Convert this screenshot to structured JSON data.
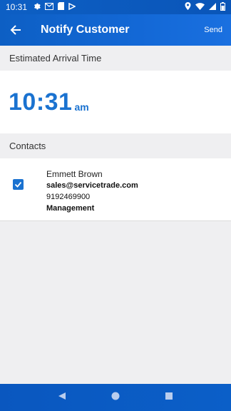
{
  "status_bar": {
    "time": "10:31",
    "left_icons": [
      "gear-icon",
      "gmail-icon",
      "sim-icon",
      "app-icon"
    ],
    "right_icons": [
      "location-icon",
      "wifi-icon",
      "signal-icon",
      "battery-icon"
    ]
  },
  "app_bar": {
    "title": "Notify Customer",
    "action": "Send"
  },
  "eta": {
    "header": "Estimated Arrival Time",
    "time": "10:31",
    "ampm": "am"
  },
  "contacts": {
    "header": "Contacts",
    "items": [
      {
        "name": "Emmett Brown",
        "email": "sales@servicetrade.com",
        "phone": "9192469900",
        "role": "Management",
        "checked": true
      }
    ]
  },
  "colors": {
    "accent": "#1a72d0",
    "app_bar": "#0d5fc4",
    "background": "#efeff1"
  }
}
